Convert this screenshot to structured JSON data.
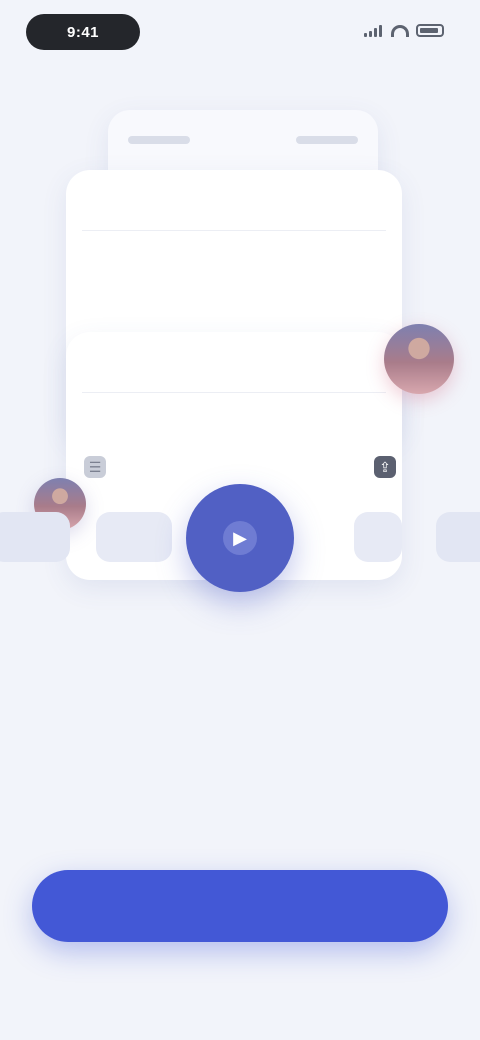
{
  "status_bar": {
    "time": "9:41",
    "icons": [
      "signal-icon",
      "wifi-icon",
      "battery-icon"
    ]
  },
  "cards": {
    "back_card_labels": [
      "",
      ""
    ],
    "front_card_1": {
      "title": "",
      "icon": "list-icon"
    },
    "front_card_2": {
      "title": "",
      "icon": "list-icon",
      "right_icon": "share-icon"
    }
  },
  "carousel": {
    "items": [
      "",
      "",
      "",
      ""
    ],
    "play_icon": "play-icon"
  },
  "headline": "",
  "subtext": "",
  "cta": {
    "label": ""
  },
  "colors": {
    "accent": "#4358d6",
    "play": "#5160c4",
    "background": "#f2f4fa"
  }
}
